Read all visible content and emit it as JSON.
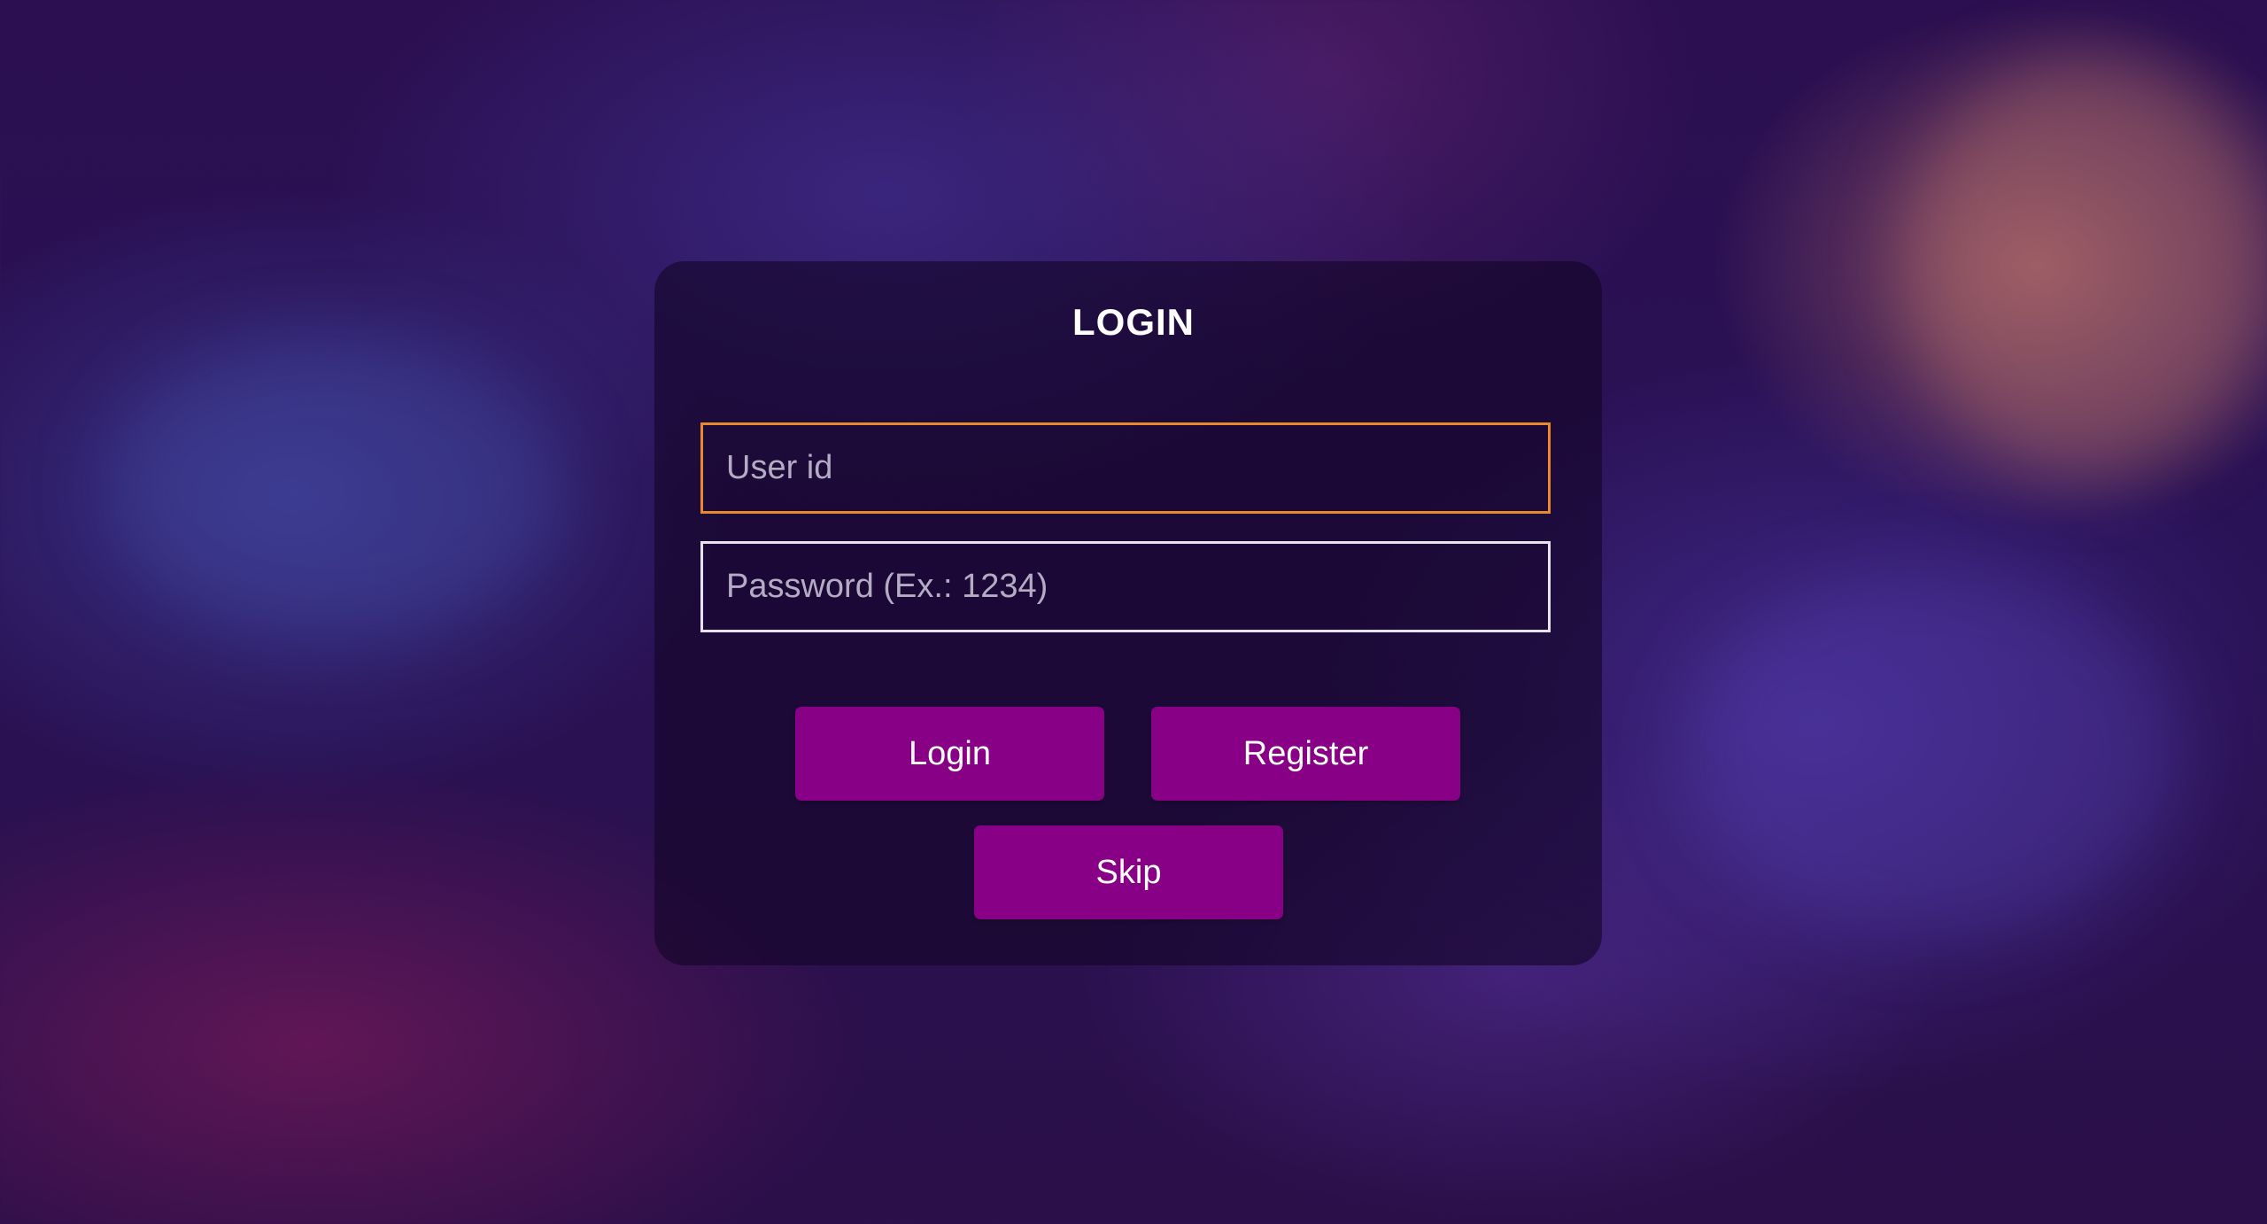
{
  "login_panel": {
    "title": "LOGIN",
    "user_id": {
      "value": "",
      "placeholder": "User id"
    },
    "password": {
      "value": "",
      "placeholder": "Password (Ex.: 1234)"
    },
    "buttons": {
      "login_label": "Login",
      "register_label": "Register",
      "skip_label": "Skip"
    }
  },
  "colors": {
    "button": "#870086",
    "focused_border": "#e8892c",
    "field_border": "#e6e3ee",
    "title_text": "#ffffff"
  }
}
